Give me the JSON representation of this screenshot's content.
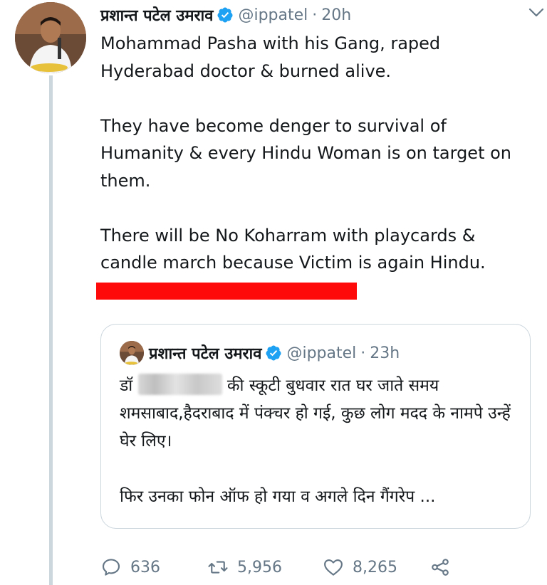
{
  "tweet": {
    "author_name": "प्रशान्त पटेल उमराव",
    "handle": "@ippatel",
    "separator": "·",
    "time": "20h",
    "paragraphs": [
      "Mohammad Pasha with his Gang, raped Hyderabad doctor & burned alive.",
      "They have become denger to survival of Humanity & every Hindu Woman is on target on them.",
      "There will be No Koharram with playcards & candle march because Victim is again Hindu."
    ],
    "redaction_color": "#ff0a0a"
  },
  "quoted_tweet": {
    "author_name": "प्रशान्त पटेल उमराव",
    "handle": "@ippatel",
    "separator": "·",
    "time": "23h",
    "line1_prefix": "डॉ",
    "line1_suffix": "की स्कूटी बुधवार रात घर जाते समय शमसाबाद,हैदराबाद में पंक्चर हो गई, कुछ लोग मदद के नामपे उन्हें घेर लिए।",
    "paragraph2": "फिर उनका फोन ऑफ हो गया व अगले दिन गैंगरेप ..."
  },
  "actions": {
    "replies": "636",
    "retweets": "5,956",
    "likes": "8,265"
  },
  "icons": [
    "verified-icon",
    "chevron-down-icon",
    "reply-icon",
    "retweet-icon",
    "like-icon",
    "share-icon"
  ],
  "colors": {
    "verified": "#1da1f2",
    "muted": "#657786",
    "border": "#ccd6dd",
    "text": "#14171a"
  }
}
